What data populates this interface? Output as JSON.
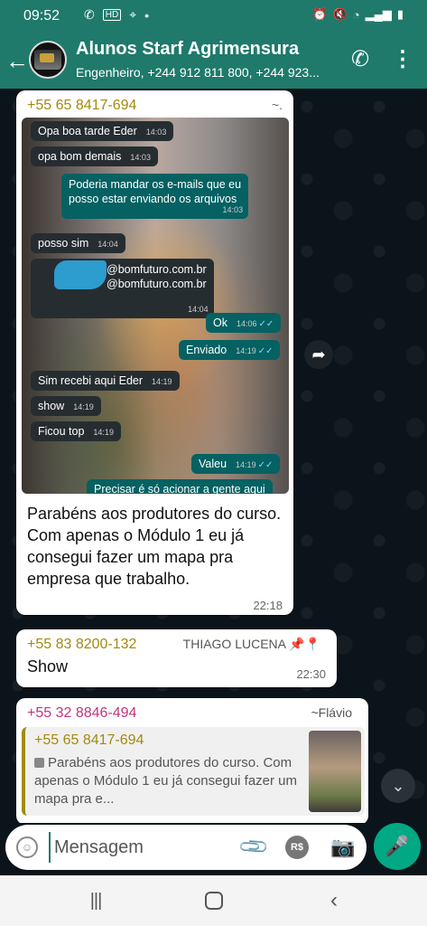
{
  "status_bar": {
    "time": "09:52",
    "left_icons": [
      "missed-call-icon",
      "hd-icon",
      "location-icon",
      "dot-icon"
    ],
    "right_icons": [
      "alarm-icon",
      "mute-icon",
      "wifi-icon",
      "signal-icon",
      "battery-icon"
    ]
  },
  "header": {
    "back_icon": "arrow-left",
    "title": "Alunos Starf Agrimensura",
    "subtitle": "Engenheiro, +244 912 811 800, +244 923...",
    "actions": [
      "add-call-icon",
      "more-vert-icon"
    ]
  },
  "messages": [
    {
      "sender": "+55 65 8417-694",
      "sender_suffix": "~.",
      "sender_color": "#a38a0e",
      "image_chat": [
        {
          "dir": "in",
          "text": "Opa boa tarde Eder",
          "time": "14:03"
        },
        {
          "dir": "in",
          "text": "opa bom demais",
          "time": "14:03"
        },
        {
          "dir": "out",
          "text": "Poderia mandar os e-mails que eu\nposso estar enviando os arquivos",
          "time": "14:03"
        },
        {
          "dir": "in",
          "text": "posso sim",
          "time": "14:04"
        },
        {
          "dir": "in",
          "text": "@bomfuturo.com.br\n@bomfuturo.com.br",
          "time": "14:04"
        },
        {
          "dir": "out",
          "text": "Ok",
          "time": "14:06"
        },
        {
          "dir": "out",
          "text": "Enviado",
          "time": "14:19"
        },
        {
          "dir": "in",
          "text": "Sim recebi aqui Eder",
          "time": "14:19"
        },
        {
          "dir": "in",
          "text": "show",
          "time": "14:19"
        },
        {
          "dir": "in",
          "text": "Ficou top",
          "time": "14:19"
        },
        {
          "dir": "out",
          "text": "Valeu",
          "time": "14:19"
        },
        {
          "dir": "out",
          "text": "Precisar é só acionar a gente aqui",
          "time": ""
        }
      ],
      "caption": "Parabéns aos produtores do curso.    Com apenas o Módulo 1 eu já consegui fazer um mapa pra empresa que trabalho.",
      "time": "22:18"
    },
    {
      "sender": "+55 83 8200-132",
      "name": "THIAGO LUCENA 📌📍",
      "sender_color": "#a38a0e",
      "text": "Show",
      "time": "22:30"
    },
    {
      "sender": "+55 32 8846-494",
      "name": "~Flávio",
      "sender_color": "#c2367a",
      "quote": {
        "sender": "+55 65 8417-694",
        "text": "Parabéns aos produtores do curso.    Com apenas o Módulo 1 eu já consegui fazer um mapa pra e..."
      }
    }
  ],
  "composer": {
    "placeholder": "Mensagem",
    "payment_label": "R$"
  }
}
